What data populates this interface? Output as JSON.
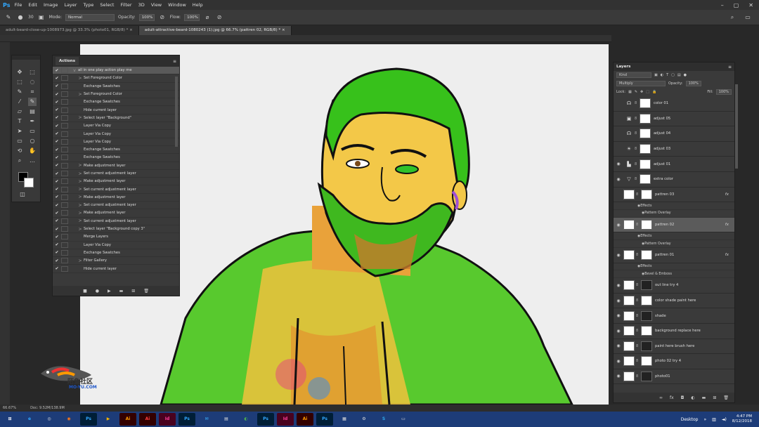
{
  "app": {
    "logo": "Ps"
  },
  "menu": [
    "File",
    "Edit",
    "Image",
    "Layer",
    "Type",
    "Select",
    "Filter",
    "3D",
    "View",
    "Window",
    "Help"
  ],
  "options": {
    "size": "30",
    "mode_label": "Mode:",
    "mode_value": "Normal",
    "opacity_label": "Opacity:",
    "opacity_value": "100%",
    "flow_label": "Flow:",
    "flow_value": "100%"
  },
  "doc_tabs": [
    {
      "label": "adult-beard-close-up-1008973.jpg @ 33.3% (photo01, RGB/8) *",
      "active": false
    },
    {
      "label": "adult-attractive-beard-1080243 (1).jpg @ 66.7% (pattren 02, RGB/8) *",
      "active": true
    }
  ],
  "actions": {
    "tab": "Actions",
    "items": [
      {
        "label": "all in one play action play me",
        "indent": 0,
        "expand": "v",
        "selected": true
      },
      {
        "label": "Set Foreground Color",
        "expand": ">"
      },
      {
        "label": "Exchange Swatches",
        "expand": ""
      },
      {
        "label": "Set Foreground Color",
        "expand": ">"
      },
      {
        "label": "Exchange Swatches",
        "expand": ""
      },
      {
        "label": "Hide current layer",
        "expand": ""
      },
      {
        "label": "Select layer \"Background\"",
        "expand": ">"
      },
      {
        "label": "Layer Via Copy",
        "expand": ""
      },
      {
        "label": "Layer Via Copy",
        "expand": ""
      },
      {
        "label": "Layer Via Copy",
        "expand": ""
      },
      {
        "label": "Exchange Swatches",
        "expand": ""
      },
      {
        "label": "Exchange Swatches",
        "expand": ""
      },
      {
        "label": "Make adjustment layer",
        "expand": ">"
      },
      {
        "label": "Set current adjustment layer",
        "expand": ">"
      },
      {
        "label": "Make adjustment layer",
        "expand": ">"
      },
      {
        "label": "Set current adjustment layer",
        "expand": ">"
      },
      {
        "label": "Make adjustment layer",
        "expand": ">"
      },
      {
        "label": "Set current adjustment layer",
        "expand": ">"
      },
      {
        "label": "Make adjustment layer",
        "expand": ">"
      },
      {
        "label": "Set current adjustment layer",
        "expand": ">"
      },
      {
        "label": "Select layer \"Background copy 3\"",
        "expand": ">"
      },
      {
        "label": "Merge Layers",
        "expand": ""
      },
      {
        "label": "Layer Via Copy",
        "expand": ""
      },
      {
        "label": "Exchange Swatches",
        "expand": ""
      },
      {
        "label": "Filter Gallery",
        "expand": ">"
      },
      {
        "label": "Hide current layer",
        "expand": ""
      }
    ]
  },
  "layers": {
    "tab": "Layers",
    "filter": "Kind",
    "blend": "Multiply",
    "opacity_label": "Opacity:",
    "opacity_value": "100%",
    "lock_label": "Lock:",
    "fill_label": "Fill:",
    "fill_value": "100%",
    "items": [
      {
        "type": "layer",
        "name": "color 01",
        "icon": "adjust-icon",
        "eye": false
      },
      {
        "type": "layer",
        "name": "adjust 05",
        "icon": "camera-icon",
        "eye": false
      },
      {
        "type": "layer",
        "name": "adjust 04",
        "icon": "adjust-icon",
        "eye": false
      },
      {
        "type": "layer",
        "name": "adjust 03",
        "icon": "sun-icon",
        "eye": false
      },
      {
        "type": "layer",
        "name": "adjust 01",
        "icon": "levels-icon",
        "eye": true
      },
      {
        "type": "layer",
        "name": "extra color",
        "icon": "triangle-icon",
        "eye": true
      },
      {
        "type": "layer",
        "name": "pattren 03",
        "thumb": true,
        "eye": false,
        "fx": "fx"
      },
      {
        "type": "effect",
        "name": "Effects"
      },
      {
        "type": "effect2",
        "name": "Pattern Overlay"
      },
      {
        "type": "layer",
        "name": "pattren 02",
        "thumb": true,
        "eye": true,
        "fx": "fx",
        "selected": true
      },
      {
        "type": "effect",
        "name": "Effects"
      },
      {
        "type": "effect2",
        "name": "Pattern Overlay"
      },
      {
        "type": "layer",
        "name": "pattren 01",
        "thumb": true,
        "eye": true,
        "fx": "fx"
      },
      {
        "type": "effect",
        "name": "Effects"
      },
      {
        "type": "effect2",
        "name": "Bevel & Emboss"
      },
      {
        "type": "layer",
        "name": "out line try 4",
        "thumb": true,
        "eye": true
      },
      {
        "type": "layer",
        "name": "color shade paint here",
        "thumb": true,
        "eye": true
      },
      {
        "type": "layer",
        "name": "shade",
        "thumb": true,
        "eye": true
      },
      {
        "type": "layer",
        "name": "background replace here",
        "thumb": true,
        "eye": true
      },
      {
        "type": "layer",
        "name": "paint here brush here",
        "thumb": true,
        "eye": true
      },
      {
        "type": "layer",
        "name": "photo 02 try 4",
        "thumb": true,
        "eye": true
      },
      {
        "type": "layer",
        "name": "photo01",
        "thumb": true,
        "eye": true
      }
    ]
  },
  "status": {
    "zoom": "66.67%",
    "doc": "Doc: 9.52M/138.9M"
  },
  "watermark": {
    "text": "陌鱼社区",
    "sub": "MO-YU.COM"
  },
  "taskbar": {
    "apps": [
      "⊞",
      "e",
      "◎",
      "◉",
      "Ps",
      "▶",
      "Ai",
      "Ai",
      "Id",
      "Ps",
      "✉",
      "▤",
      "◐",
      "Ps",
      "Id",
      "Ai",
      "Ps",
      "▦",
      "⚙",
      "S",
      "▭"
    ],
    "desktop": "Desktop",
    "time": "4:47 PM",
    "date": "8/12/2018"
  },
  "colors": {
    "accent": "#31a8ff",
    "taskbar": "#1d3c78",
    "green": "#3cc21d",
    "yellow": "#f3c53a"
  }
}
